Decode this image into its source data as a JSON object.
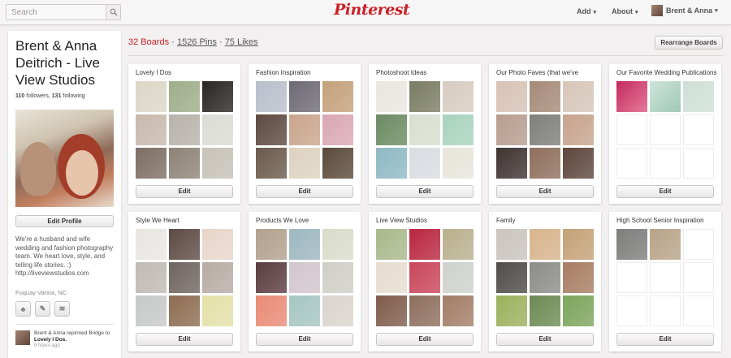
{
  "header": {
    "search_placeholder": "Search",
    "logo": "Pinterest",
    "nav_add": "Add",
    "nav_about": "About",
    "nav_user": "Brent & Anna"
  },
  "profile": {
    "name": "Brent & Anna Deitrich - Live View Studios",
    "followers_count": "110",
    "followers_label": "followers,",
    "following_count": "131",
    "following_label": "following",
    "edit_button": "Edit Profile",
    "about": "We're a husband and wife wedding and fashion photography team. We heart love, style, and telling life stories. :) http://liveviewstudios.com",
    "location": "Fuquay Varina, NC",
    "activity": {
      "text_pre": "Brent & Anna repinned Bridge to",
      "board": "Lovely I Dos.",
      "time": "9 hours ago"
    }
  },
  "boards_header": {
    "boards": "32 Boards",
    "pins": "1526 Pins",
    "likes": "75 Likes",
    "sep": "·",
    "rearrange": "Rearrange Boards"
  },
  "boards": [
    {
      "title": "Lovely I Dos",
      "edit": "Edit",
      "colors": [
        "#dcd6c8",
        "#9fae8a",
        "#2b2626",
        "#c9b9ad",
        "#b7b3ab",
        "#dcdcd6",
        "#7e6e64",
        "#8d8475",
        "#c6c2b9"
      ]
    },
    {
      "title": "Fashion Inspiration",
      "edit": "Edit",
      "colors": [
        "#b9bfcb",
        "#6d6a75",
        "#c4a17b",
        "#5d4a3f",
        "#c9a58d",
        "#d9a7b4",
        "#6b5a4c",
        "#ddd2c0",
        "#5b4a3b"
      ]
    },
    {
      "title": "Photoshoot Ideas",
      "edit": "Edit",
      "colors": [
        "#eae6e0",
        "#7a7d63",
        "#d7ccc1",
        "#6b8b62",
        "#d8dfd0",
        "#a8d3be",
        "#8fb9c4",
        "#d9dde1",
        "#e7e4db"
      ]
    },
    {
      "title": "Our Photo Faves (that we've",
      "edit": "Edit",
      "colors": [
        "#d8c2b6",
        "#a68a78",
        "#d6c6b8",
        "#b79d8f",
        "#7e7e7b",
        "#c7a48e",
        "#3e3432",
        "#8f6f5c",
        "#5d463c"
      ]
    },
    {
      "title": "Our Favorite Wedding Publications",
      "edit": "Edit",
      "colors": [
        "pink",
        "mint",
        "#cfe0d8",
        "empty",
        "empty",
        "empty",
        "empty",
        "empty",
        "empty"
      ]
    },
    {
      "title": "Style We Heart",
      "edit": "Edit",
      "colors": [
        "#e9e6e2",
        "#5e4a44",
        "#e8d5c9",
        "#bfbab3",
        "#6f6560",
        "#b8aba5",
        "#c6c9c8",
        "#8d6d52",
        "#e4e0a8"
      ]
    },
    {
      "title": "Products We Love",
      "edit": "Edit",
      "colors": [
        "#b2a18d",
        "#9db7c0",
        "#d9dcc9",
        "#5a3c40",
        "#d1c6cc",
        "#cfcfc7",
        "#e98b76",
        "#a6c6c1",
        "#d9d4cd"
      ]
    },
    {
      "title": "Live View Studios",
      "edit": "Edit",
      "colors": [
        "#a9b88c",
        "#b9273f",
        "#b9b08e",
        "#e7dcd0",
        "#c9465a",
        "#cfd1cd",
        "#7f5c4b",
        "#8e6f5d",
        "#a27e67"
      ]
    },
    {
      "title": "Family",
      "edit": "Edit",
      "colors": [
        "#c9c4bf",
        "#d7b48c",
        "#c4a277",
        "#4f4c49",
        "#8c8c88",
        "#a77d62",
        "#9db15d",
        "#6c8b55",
        "#7ca55c"
      ]
    },
    {
      "title": "High School Senior Inspiration",
      "edit": "Edit",
      "colors": [
        "#7e7e7c",
        "#b9a488",
        "empty",
        "empty",
        "empty",
        "empty",
        "empty",
        "empty",
        "empty"
      ]
    }
  ]
}
